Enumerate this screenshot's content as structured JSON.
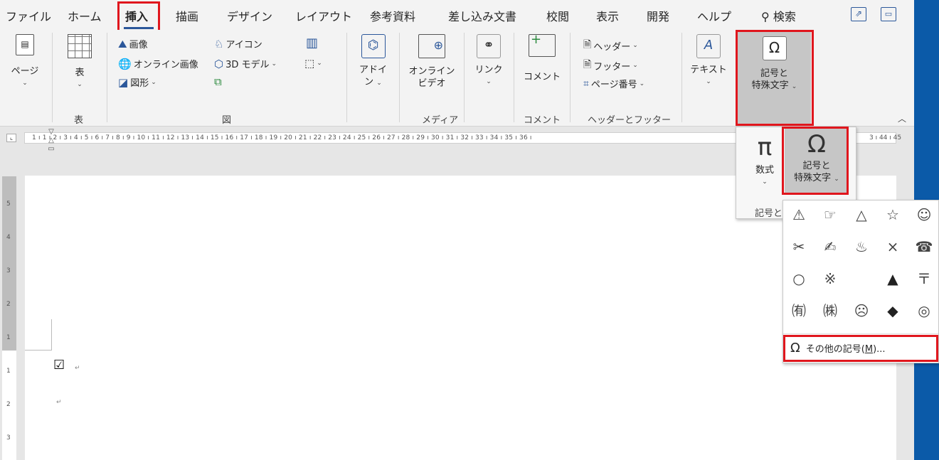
{
  "tabs": {
    "file": "ファイル",
    "home": "ホーム",
    "insert": "挿入",
    "draw": "描画",
    "design": "デザイン",
    "layout": "レイアウト",
    "references": "参考資料",
    "mailings": "差し込み文書",
    "review": "校閲",
    "view": "表示",
    "developer": "開発",
    "help": "ヘルプ",
    "search": "検索"
  },
  "ribbon": {
    "page": "ページ",
    "table": "表",
    "image": "画像",
    "online_image": "オンライン画像",
    "shape": "図形",
    "icon": "アイコン",
    "model3d": "3D モデル",
    "addin_line1": "アドイ",
    "addin_line2": "ン",
    "online_video_line1": "オンライン",
    "online_video_line2": "ビデオ",
    "link": "リンク",
    "comment": "コメント",
    "header": "ヘッダー",
    "footer": "フッター",
    "page_number": "ページ番号",
    "text": "テキスト",
    "symbol_line1": "記号と",
    "symbol_line2": "特殊文字"
  },
  "groups": {
    "table": "表",
    "illustrations": "図",
    "media": "メディア",
    "comments": "コメント",
    "header_footer": "ヘッダーとフッター"
  },
  "ruler": {
    "start": "1",
    "text": "1 ı 1 ı 2 ı 3 ı 4 ı 5 ı 6 ı 7 ı 8 ı 9 ı 10 ı 11 ı 12 ı 13 ı 14 ı 15 ı 16 ı 17 ı 18 ı 19 ı 20 ı 21 ı 22 ı 23 ı 24 ı 25 ı 26 ı 27 ı 28 ı 29 ı 30 ı 31 ı 32 ı 33 ı 34 ı 35 ı 36 ı",
    "end": "3 ı 44 ı 45",
    "vertical": [
      "5",
      "4",
      "3",
      "2",
      "1",
      "1",
      "2",
      "3"
    ]
  },
  "dropdown1": {
    "equation": "数式",
    "symbol_line1": "記号と",
    "symbol_line2": "特殊文字",
    "group_label": "記号と"
  },
  "symbols": [
    "⚠",
    "☞",
    "△",
    "☆",
    "☺",
    "✂",
    "✍",
    "♨",
    "×",
    "☎",
    "○",
    "※",
    "",
    "▲",
    "〒",
    "㈲",
    "㈱",
    "☹",
    "◆",
    "◎"
  ],
  "more_symbols": "その他の記号(",
  "more_symbols_key": "M",
  "more_symbols_end": ")...",
  "doc": {
    "checkbox": "☑",
    "para_mark": "↵"
  }
}
